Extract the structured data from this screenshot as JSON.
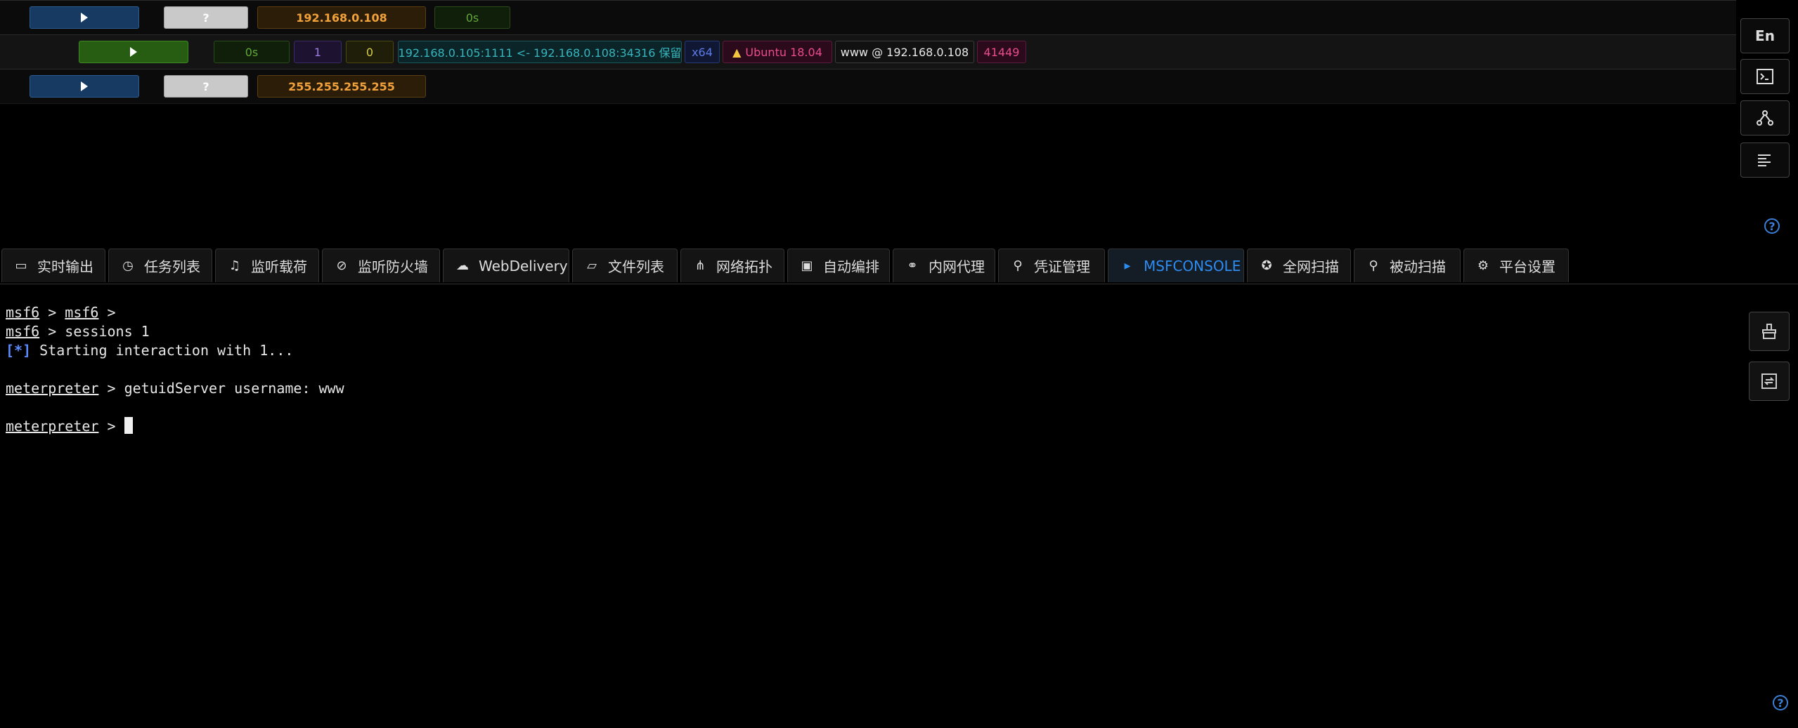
{
  "hosts": [
    {
      "ip": "192.168.0.108",
      "unknown": "?",
      "last_seen": "0s"
    },
    {
      "ip": "255.255.255.255",
      "unknown": "?"
    }
  ],
  "session": {
    "time": "0s",
    "id": "1",
    "count": "0",
    "connection": "192.168.0.105:1111 <- 192.168.0.108:34316 保留",
    "arch": "x64",
    "os": "Ubuntu 18.04",
    "user": "www @ 192.168.0.108",
    "pid": "41449"
  },
  "side": {
    "lang": "En",
    "help": "?"
  },
  "tabs": [
    {
      "label": "实时输出",
      "icon": "display-icon"
    },
    {
      "label": "任务列表",
      "icon": "clock-icon"
    },
    {
      "label": "监听载荷",
      "icon": "headphones-icon"
    },
    {
      "label": "监听防火墙",
      "icon": "stop-icon"
    },
    {
      "label": "WebDelivery",
      "icon": "cloud-icon"
    },
    {
      "label": "文件列表",
      "icon": "folder-icon"
    },
    {
      "label": "网络拓扑",
      "icon": "network-icon"
    },
    {
      "label": "自动编排",
      "icon": "robot-icon"
    },
    {
      "label": "内网代理",
      "icon": "proxy-icon"
    },
    {
      "label": "凭证管理",
      "icon": "key-icon"
    },
    {
      "label": "MSFCONSOLE",
      "icon": "terminal-icon",
      "active": true
    },
    {
      "label": "全网扫描",
      "icon": "radar-icon"
    },
    {
      "label": "被动扫描",
      "icon": "search-icon"
    },
    {
      "label": "平台设置",
      "icon": "gear-icon"
    }
  ],
  "console": {
    "l1_a": "msf6",
    "l1_sep": " > ",
    "l1_b": "msf6",
    "l1_end": " >",
    "l2_a": "msf6",
    "l2_cmd": " > sessions 1",
    "l3_star": "[*]",
    "l3_text": " Starting interaction with 1...",
    "l5_prompt": "meterpreter",
    "l5_text": " > getuidServer username: www",
    "l7_prompt": "meterpreter",
    "l7_text": " > "
  },
  "colors": {
    "accent": "#2d8cf0",
    "orange": "#f0a13a"
  }
}
